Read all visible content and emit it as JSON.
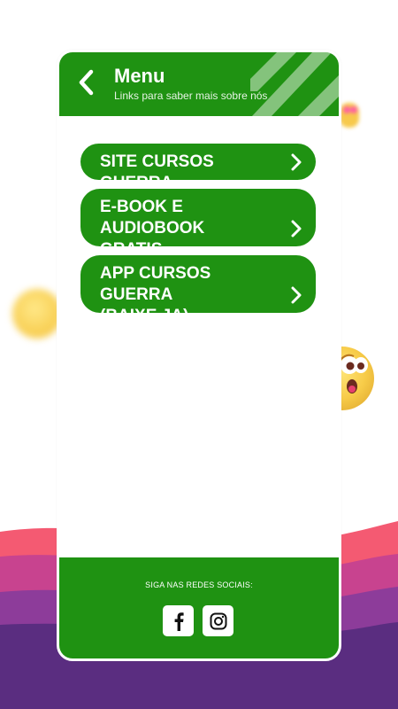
{
  "colors": {
    "primary": "#1f9212",
    "white": "#ffffff",
    "emoji_yellow": "#f9d25a"
  },
  "header": {
    "back_icon": "chevron-left-icon",
    "title": "Menu",
    "subtitle": "Links para saber mais sobre nós"
  },
  "menu": {
    "items": [
      {
        "label": "SITE CURSOS GUERRA",
        "icon": "chevron-right-icon"
      },
      {
        "label": "E-BOOK E AUDIOBOOK\nGRATIS",
        "icon": "chevron-right-icon"
      },
      {
        "label": "APP CURSOS GUERRA\n(BAIXE JA)",
        "icon": "chevron-right-icon"
      }
    ]
  },
  "footer": {
    "label": "SIGA NAS REDES SOCIAIS:",
    "socials": [
      {
        "name": "facebook",
        "icon": "facebook-icon"
      },
      {
        "name": "instagram",
        "icon": "instagram-icon"
      }
    ]
  }
}
